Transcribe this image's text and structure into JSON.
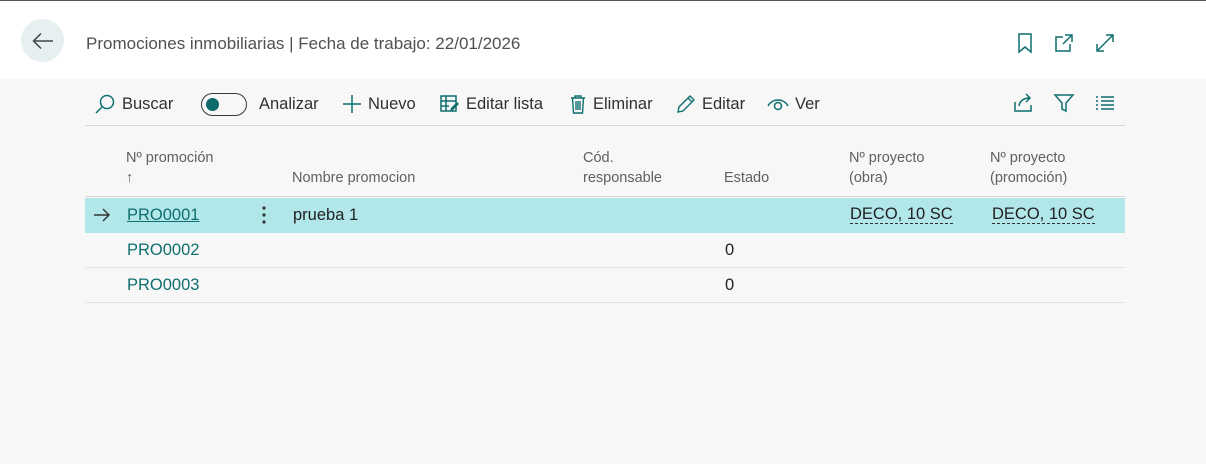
{
  "header": {
    "title": "Promociones inmobiliarias | Fecha de trabajo: 22/01/2026",
    "icons": [
      "back-arrow-icon",
      "bookmark-icon",
      "open-new-window-icon",
      "expand-icon"
    ]
  },
  "toolbar": {
    "search_label": "Buscar",
    "analyze_label": "Analizar",
    "analyze_on": false,
    "new_label": "Nuevo",
    "edit_list_label": "Editar lista",
    "delete_label": "Eliminar",
    "edit_label": "Editar",
    "view_label": "Ver",
    "right_icons": [
      "share-icon",
      "filter-icon",
      "list-view-icon"
    ]
  },
  "grid": {
    "columns": {
      "promo_no": "Nº promoción",
      "promo_no_sort": "↑",
      "name": "Nombre promocion",
      "resp_1": "Cód.",
      "resp_2": "responsable",
      "status": "Estado",
      "proj_work_1": "Nº proyecto",
      "proj_work_2": "(obra)",
      "proj_promo_1": "Nº proyecto",
      "proj_promo_2": "(promoción)"
    },
    "rows": [
      {
        "no": "PRO0001",
        "name": "prueba 1",
        "resp": "",
        "status": "",
        "proj_work": "DECO, 10 SC",
        "proj_promo": "DECO, 10 SC",
        "selected": true
      },
      {
        "no": "PRO0002",
        "name": "",
        "resp": "",
        "status": "0",
        "proj_work": "",
        "proj_promo": "",
        "selected": false
      },
      {
        "no": "PRO0003",
        "name": "",
        "resp": "",
        "status": "0",
        "proj_work": "",
        "proj_promo": "",
        "selected": false
      }
    ]
  },
  "colors": {
    "accent": "#0f6f6f",
    "selected_row": "#b2e7ea",
    "back_button_bg": "#e6f0f1",
    "page_bg": "#f7f7f7"
  }
}
